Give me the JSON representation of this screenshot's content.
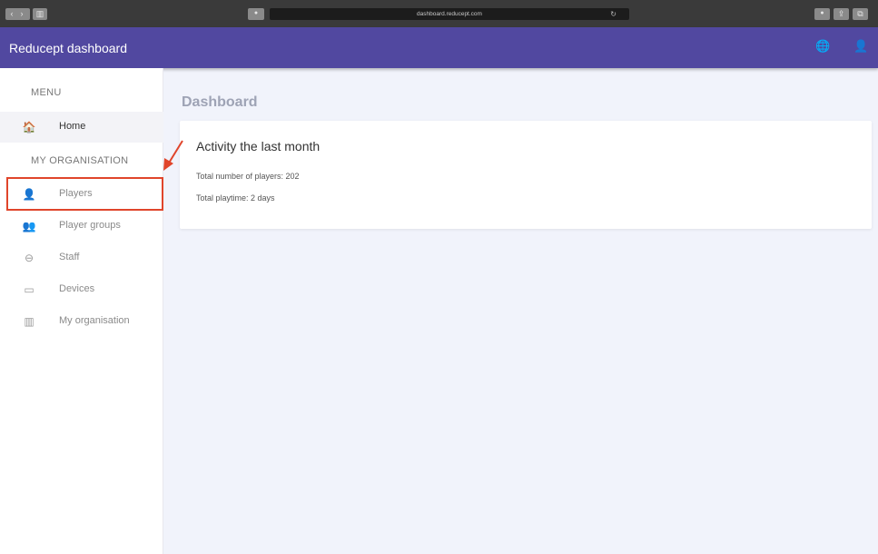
{
  "browser": {
    "url": "dashboard.reducept.com",
    "lock_glyph": "🔒",
    "reload_glyph": "↻",
    "nav_back_glyph": "‹",
    "nav_fwd_glyph": "›",
    "sidebar_glyph": "▥",
    "shield_glyph": "●",
    "share_glyph": "⇪",
    "tabs_glyph": "⧉",
    "extension_glyph": "●"
  },
  "header": {
    "title": "Reducept dashboard",
    "globe_glyph": "🌐",
    "user_glyph": "👤"
  },
  "sidebar": {
    "menu_label": "MENU",
    "org_label": "MY ORGANISATION",
    "items": [
      {
        "label": "Home",
        "icon": "home-icon",
        "glyph": "🏠"
      },
      {
        "label": "Players",
        "icon": "person-icon",
        "glyph": "👤"
      },
      {
        "label": "Player groups",
        "icon": "group-icon",
        "glyph": "👥"
      },
      {
        "label": "Staff",
        "icon": "badge-icon",
        "glyph": "⊖"
      },
      {
        "label": "Devices",
        "icon": "device-icon",
        "glyph": "▭"
      },
      {
        "label": "My organisation",
        "icon": "building-icon",
        "glyph": "▥"
      }
    ]
  },
  "main": {
    "page_title": "Dashboard",
    "card": {
      "title": "Activity the last month",
      "players_line": "Total number of players: 202",
      "playtime_line": "Total playtime: 2 days"
    }
  },
  "colors": {
    "accent": "#5148a0",
    "annotation": "#e0452b",
    "background": "#f1f3fb"
  }
}
